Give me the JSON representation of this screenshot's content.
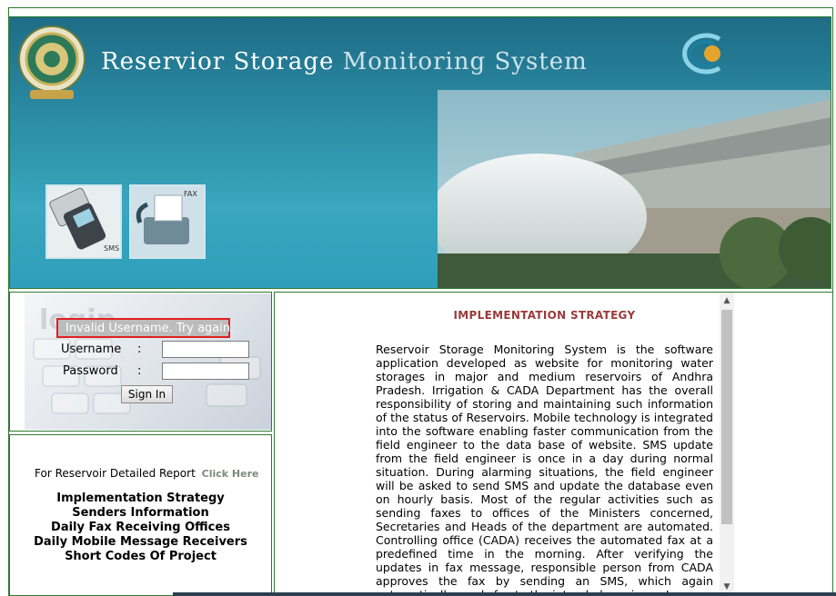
{
  "header": {
    "title_part1": "Reservior Storage",
    "title_part2": "Monitoring System",
    "emblem": "andhra-pradesh-emblem",
    "logo": "swirl-logo",
    "tiles": [
      {
        "label": "SMS",
        "icon": "mobile-phone-icon"
      },
      {
        "label": "FAX",
        "icon": "fax-machine-icon"
      }
    ]
  },
  "login": {
    "watermark": "login",
    "error": "Invalid Username. Try again.",
    "username_label": "Username",
    "password_label": "Password",
    "colon": ":",
    "username_value": "",
    "password_value": "",
    "signin_label": "Sign In"
  },
  "sidebar": {
    "report_text": "For Reservoir Detailed Report",
    "report_link": "Click Here",
    "links": [
      "Implementation Strategy",
      "Senders Information",
      "Daily Fax Receiving Offices",
      "Daily Mobile Message Receivers",
      "Short Codes Of Project"
    ]
  },
  "content": {
    "heading": "IMPLEMENTATION STRATEGY",
    "body": "Reservoir Storage Monitoring System is the software application developed as website for monitoring water storages in major and medium reservoirs of Andhra Pradesh. Irrigation & CADA Department has the overall responsibility of storing and maintaining such information of the status of Reservoirs. Mobile technology is integrated into the software enabling faster communication from the field engineer to the data base of website. SMS update from the field engineer is once in a day during normal situation. During alarming situations, the field engineer will be asked to send SMS and update the database even on hourly basis. Most of the regular activities such as sending faxes to offices of the Ministers concerned, Secretaries and Heads of the department are automated. Controlling office (CADA) receives the automated fax at a predefined time in the morning. After verifying the updates in fax message, responsible person from CADA approves the fax by sending an SMS, which again automatically sends fax to the intended receivers. In"
  },
  "colors": {
    "frame_green": "#2f7a2f",
    "heading_red": "#9b3b3b",
    "error_border": "#e02020"
  }
}
